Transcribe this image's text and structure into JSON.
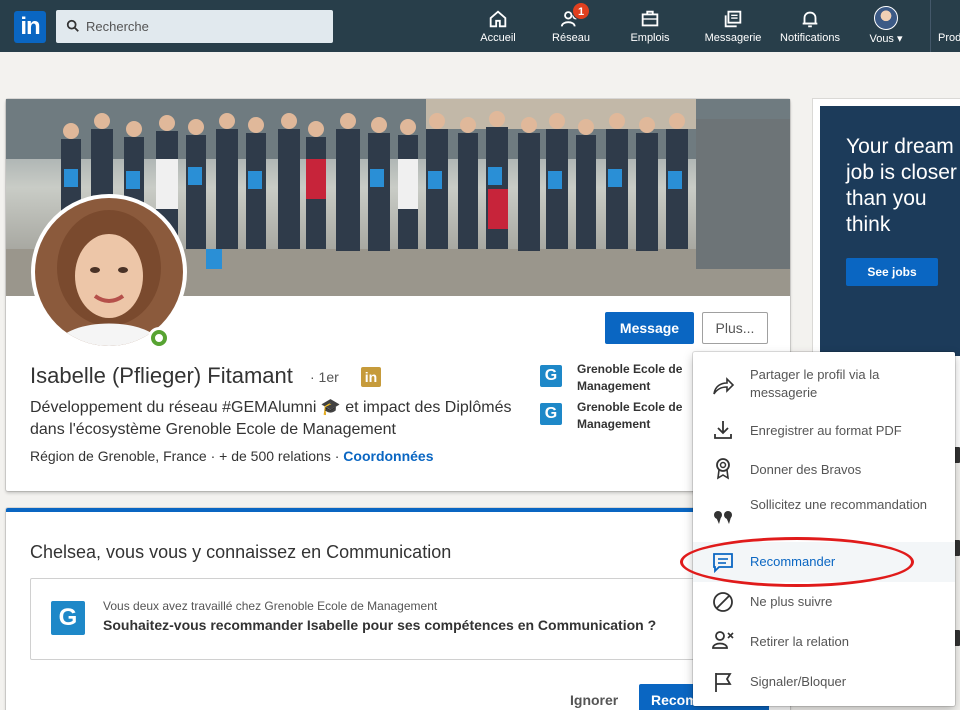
{
  "nav": {
    "logo": "in",
    "search_placeholder": "Recherche",
    "items": [
      {
        "label": "Accueil"
      },
      {
        "label": "Réseau",
        "badge": "1"
      },
      {
        "label": "Emplois"
      },
      {
        "label": "Messagerie"
      },
      {
        "label": "Notifications"
      },
      {
        "label": "Vous ▾"
      },
      {
        "label": "Prod"
      }
    ]
  },
  "profile": {
    "name": "Isabelle (Pflieger) Fitamant",
    "degree": "· 1er",
    "badge": "in",
    "headline": "Développement du réseau #GEMAlumni 🎓 et impact des Diplômés dans l'écosystème Grenoble Ecole de Management",
    "location": "Région de Grenoble, France",
    "connections": "+ de 500 relations",
    "contact": "Coordonnées",
    "message_button": "Message",
    "more_button": "Plus...",
    "education": [
      {
        "name": "Grenoble Ecole de Management"
      },
      {
        "name": "Grenoble Ecole de Management"
      }
    ]
  },
  "recommend": {
    "title": "Chelsea, vous vous y connaissez en Communication",
    "context": "Vous deux avez travaillé chez Grenoble Ecole de Management",
    "question": "Souhaitez-vous recommander Isabelle pour ses compétences en Communication ?",
    "ignore": "Ignorer",
    "action": "Recommander"
  },
  "ad": {
    "headline": "Your dream job is closer than you think",
    "button": "See jobs"
  },
  "menu": {
    "items": [
      {
        "label": "Partager le profil via la messagerie",
        "icon": "share-icon"
      },
      {
        "label": "Enregistrer au format PDF",
        "icon": "download-icon"
      },
      {
        "label": "Donner des Bravos",
        "icon": "award-icon"
      },
      {
        "label": "Sollicitez une recommandation",
        "icon": "quote-icon"
      },
      {
        "label": "Recommander",
        "icon": "comment-icon",
        "active": true
      },
      {
        "label": "Ne plus suivre",
        "icon": "unfollow-icon"
      },
      {
        "label": "Retirer la relation",
        "icon": "remove-connection-icon"
      },
      {
        "label": "Signaler/Bloquer",
        "icon": "flag-icon"
      }
    ]
  },
  "colors": {
    "nav_bg": "#283e4a",
    "primary": "#0a66c2",
    "highlight": "#e01b1b",
    "online": "#57a332"
  }
}
